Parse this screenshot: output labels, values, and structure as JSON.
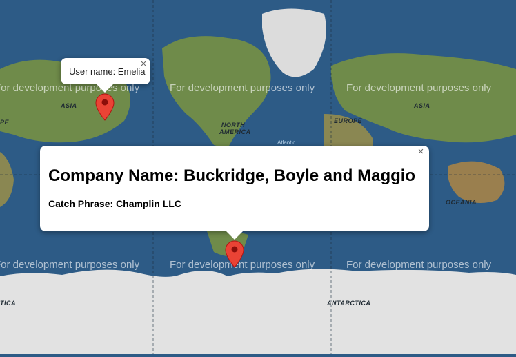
{
  "map": {
    "watermark_text": "For development purposes only",
    "continent_labels": [
      "ASIA",
      "NORTH AMERICA",
      "EUROPE",
      "ASIA",
      "OCEANIA",
      "ANTARCTICA",
      "ANTARCTICA"
    ],
    "partial_labels": [
      "PE",
      "TICA"
    ],
    "ocean_labels": [
      "Atlantic"
    ],
    "colors": {
      "ocean": "#2d5b86",
      "land": "#6f8b4a",
      "ice": "#e2e2e2",
      "marker": "#ea4335"
    }
  },
  "markers": [
    {
      "name": "marker-asia",
      "icon": "map-pin-icon"
    },
    {
      "name": "marker-south",
      "icon": "map-pin-icon"
    }
  ],
  "infowindow_small": {
    "text": "User name: Emelia",
    "close": "×"
  },
  "infowindow_large": {
    "title": "Company Name: Buckridge, Boyle and Maggio",
    "subtitle": "Catch Phrase: Champlin LLC",
    "close": "×"
  }
}
